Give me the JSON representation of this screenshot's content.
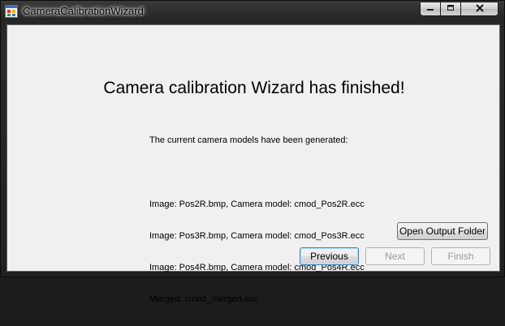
{
  "window": {
    "title": "CameraCalibrationWizard"
  },
  "caption": {
    "minimize_icon": "minimize-icon",
    "maximize_icon": "maximize-icon",
    "close_icon": "close-icon"
  },
  "content": {
    "heading": "Camera calibration Wizard has finished!",
    "intro": "The current camera models have been generated:",
    "lines": [
      "Image: Pos2R.bmp, Camera model: cmod_Pos2R.ecc",
      "Image: Pos3R.bmp, Camera model: cmod_Pos3R.ecc",
      "Image: Pos4R.bmp, Camera model: cmod_Pos4R.ecc",
      "Merged: cmod_merged.ecc"
    ]
  },
  "buttons": {
    "open_output_folder": "Open Output Folder",
    "previous": "Previous",
    "next": "Next",
    "finish": "Finish"
  },
  "colors": {
    "client_background": "#f0f0f0",
    "default_button_border": "#3c7fb1",
    "disabled_text": "#9a9a9a"
  }
}
